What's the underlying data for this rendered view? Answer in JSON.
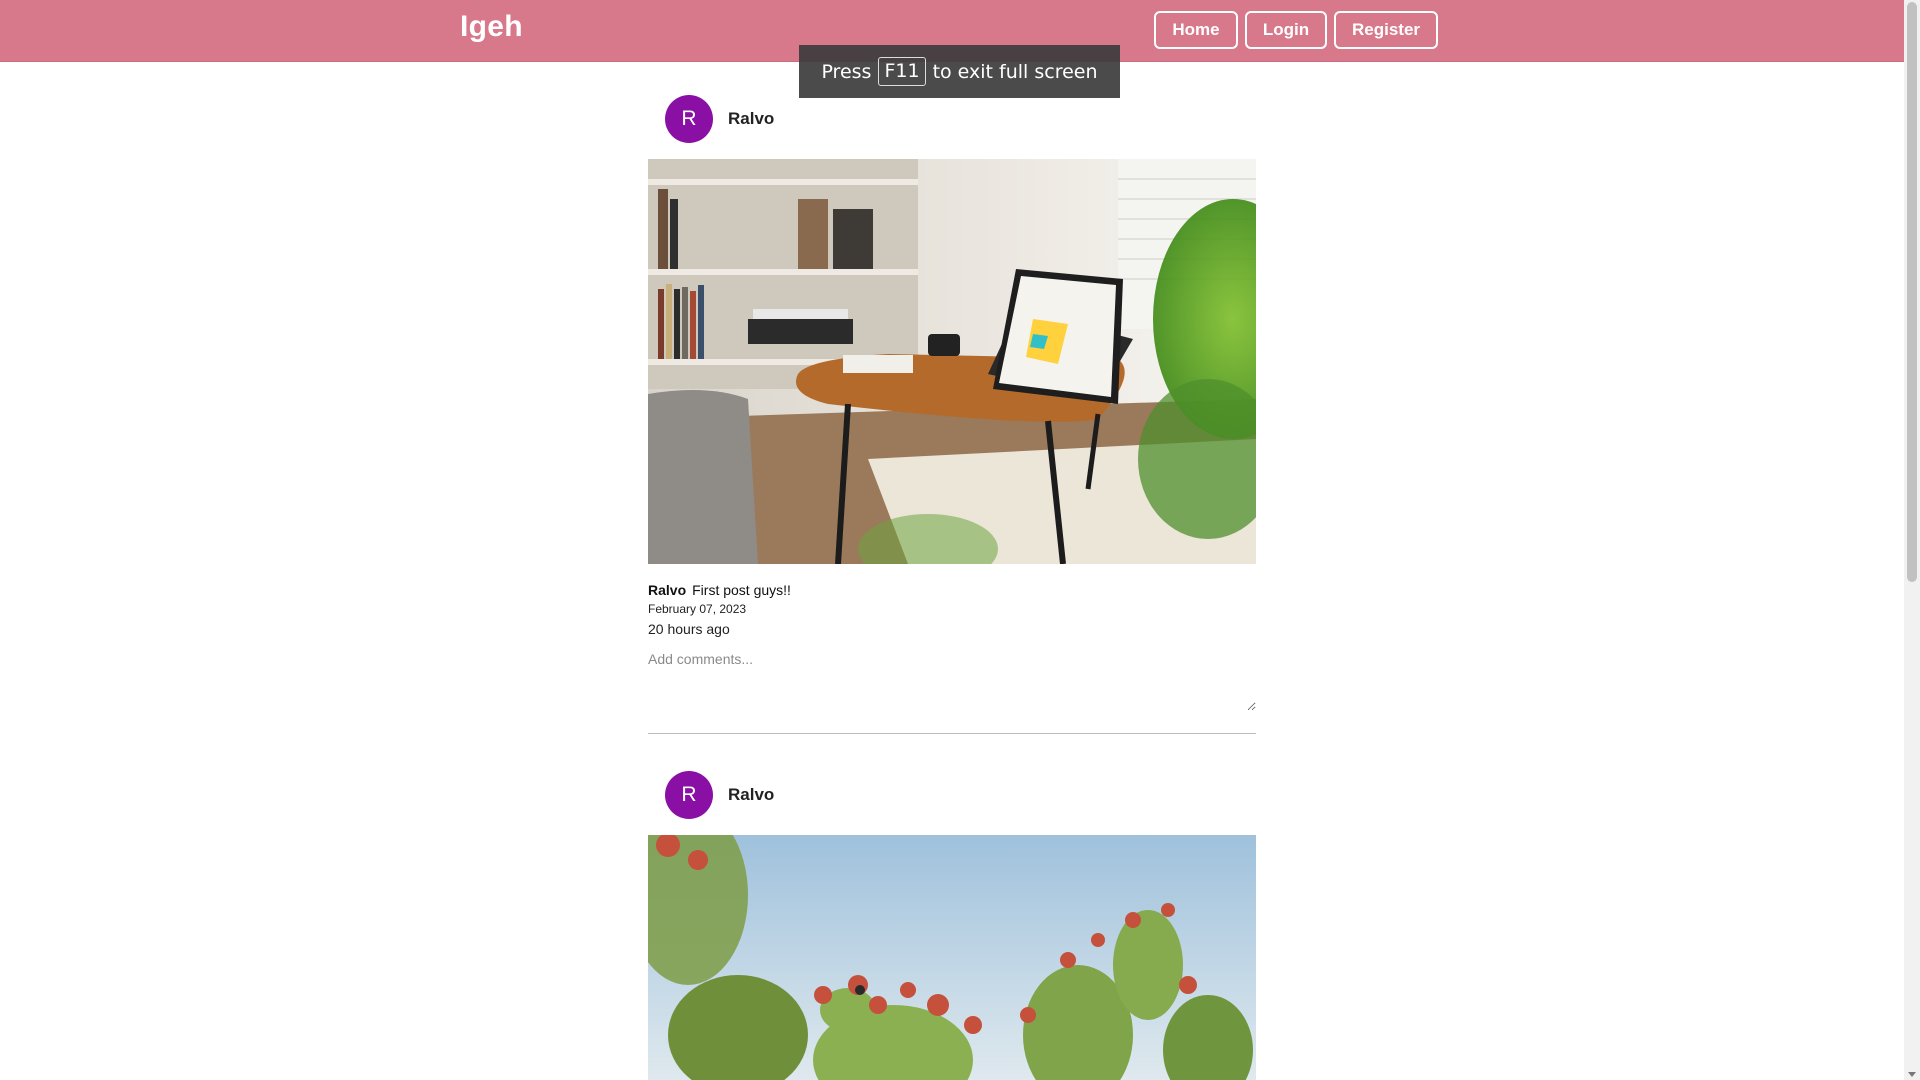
{
  "header": {
    "brand": "Igeh",
    "nav": {
      "home": "Home",
      "login": "Login",
      "register": "Register"
    },
    "accent": "#d8798b"
  },
  "fullscreen_toast": {
    "prefix": "Press",
    "key": "F11",
    "suffix": "to exit full screen"
  },
  "posts": [
    {
      "avatar_letter": "R",
      "author": "Ralvo",
      "image": "laptop-on-side-table-photo",
      "caption_author": "Ralvo",
      "caption": "First post guys!!",
      "date": "February 07, 2023",
      "relative_time": "20 hours ago",
      "comment_placeholder": "Add comments..."
    },
    {
      "avatar_letter": "R",
      "author": "Ralvo",
      "image": "cactus-against-sky-photo"
    }
  ]
}
